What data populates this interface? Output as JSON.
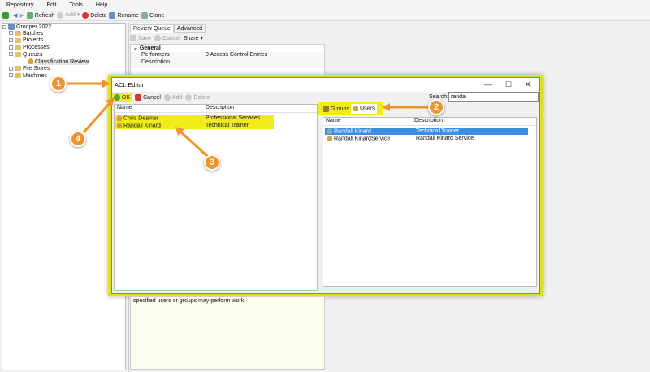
{
  "menu": [
    "Repository",
    "Edit",
    "Tools",
    "Help"
  ],
  "toolbar": {
    "refresh": "Refresh",
    "add": "Add",
    "delete": "Delete",
    "rename": "Rename",
    "clone": "Clone"
  },
  "tree": {
    "root": "Grooper 2022",
    "items": [
      "Batches",
      "Projects",
      "Processes",
      "Queues"
    ],
    "child": "Classification Review",
    "items2": [
      "File Stores",
      "Machines"
    ]
  },
  "tabs": [
    "Review Queue",
    "Advanced"
  ],
  "subtoolbar": {
    "save": "Save",
    "cancel": "Cancel",
    "share": "Share ▾"
  },
  "grid": {
    "category": "General",
    "rows": [
      {
        "name": "Performers",
        "value": "0 Access Control Entries"
      },
      {
        "name": "Description",
        "value": ""
      }
    ]
  },
  "help": "specified users or groups may perform work.",
  "dialog": {
    "title": "ACL Editor",
    "ok": "OK",
    "cancel": "Cancel",
    "add": "Add",
    "delete": "Delete",
    "search_label": "Search:",
    "search_value": "randa",
    "left": {
      "headers": [
        "Name",
        "Description"
      ],
      "rows": [
        [
          "Chris Deamer",
          "Professional Services"
        ],
        [
          "Randall Kinard",
          "Technical Trainer"
        ]
      ]
    },
    "right_tabs": [
      "Groups",
      "Users"
    ],
    "right": {
      "headers": [
        "Name",
        "Description"
      ],
      "rows": [
        [
          "Randall Kinard",
          "Technical Trainer"
        ],
        [
          "Randall KinardService",
          "Randall Kinard Service"
        ]
      ]
    }
  },
  "callouts": [
    "1",
    "2",
    "3",
    "4"
  ],
  "colors": {
    "highlight": "#f0ec1a",
    "callout": "#f39325",
    "selection": "#3a8ee6"
  }
}
